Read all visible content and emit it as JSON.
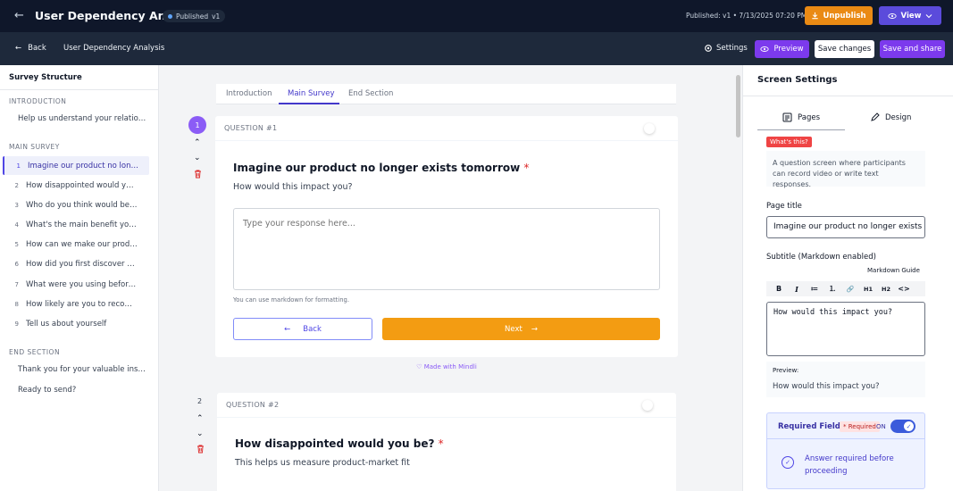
{
  "topbar": {
    "title": "User Dependency Analysis",
    "badge_status": "Published",
    "badge_version": "v1",
    "published_meta": "Published: v1 • 7/13/2025 07:20 PM",
    "unpublish_label": "Unpublish",
    "view_label": "View"
  },
  "subbar": {
    "back_label": "Back",
    "title": "User Dependency Analysis",
    "settings_label": "Settings",
    "preview_label": "Preview",
    "save_label": "Save changes",
    "save_share_label": "Save and share"
  },
  "sidebar": {
    "heading": "Survey Structure",
    "intro_section": "INTRODUCTION",
    "intro_items": [
      "Help us understand your relationship..."
    ],
    "main_section": "MAIN SURVEY",
    "questions": [
      {
        "num": "1",
        "text": "Imagine our product no longer exists tomorrow"
      },
      {
        "num": "2",
        "text": "How disappointed would you be?"
      },
      {
        "num": "3",
        "text": "Who do you think would benefit most?"
      },
      {
        "num": "4",
        "text": "What's the main benefit you receive?"
      },
      {
        "num": "5",
        "text": "How can we make our product better?"
      },
      {
        "num": "6",
        "text": "How did you first discover our product?"
      },
      {
        "num": "7",
        "text": "What were you using before our product?"
      },
      {
        "num": "8",
        "text": "How likely are you to recommend us?"
      },
      {
        "num": "9",
        "text": "Tell us about yourself"
      }
    ],
    "end_section": "END SECTION",
    "end_items": [
      "Thank you for your valuable insights!",
      "Ready to send?"
    ]
  },
  "center": {
    "tabs": [
      "Introduction",
      "Main Survey",
      "End Section"
    ],
    "q1": {
      "number": "1",
      "header": "QUESTION #1",
      "title": "Imagine our product no longer exists tomorrow",
      "required_mark": "*",
      "subtitle": "How would this impact you?",
      "placeholder": "Type your response here...",
      "hint": "You can use markdown for formatting.",
      "back_label": "Back",
      "next_label": "Next",
      "made_with": "Made with Mindli"
    },
    "q2": {
      "number": "2",
      "header": "QUESTION #2",
      "title": "How disappointed would you be?",
      "required_mark": "*",
      "subtitle": "This helps us measure product-market fit"
    }
  },
  "rpanel": {
    "heading": "Screen Settings",
    "tab_pages": "Pages",
    "tab_design": "Design",
    "whats_this": "What's this?",
    "info_text": "A question screen where participants can record video or write text responses.",
    "page_title_label": "Page title",
    "page_title_value": "Imagine our product no longer exists tomorrow",
    "subtitle_label": "Subtitle (Markdown enabled)",
    "markdown_guide": "Markdown Guide",
    "toolbar": [
      "B",
      "I",
      "≔",
      "⒈",
      "🔗",
      "H1",
      "H2",
      "<>"
    ],
    "subtitle_value": "How would this impact you?",
    "preview_label": "Preview:",
    "preview_text": "How would this impact you?",
    "required_label": "Required Field",
    "required_pill": "* Required",
    "required_state": "ON",
    "required_desc": "Answer required before proceeding"
  },
  "colors": {
    "accent": "#7c3aed",
    "unpublish": "#ea8a14",
    "next": "#f39c12",
    "required": "#dc2626"
  }
}
